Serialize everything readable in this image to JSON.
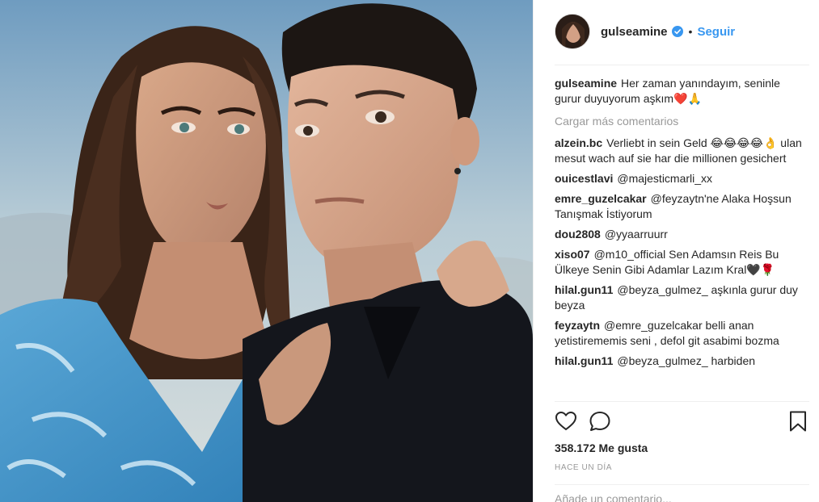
{
  "post": {
    "username": "gulseamine",
    "follow_label": "Seguir",
    "separator_dot": "•",
    "caption": {
      "username": "gulseamine",
      "text": "Her zaman yanındayım, seninle gurur duyuyorum aşkım❤️🙏"
    },
    "load_more_label": "Cargar más comentarios",
    "comments": [
      {
        "username": "alzein.bc",
        "text": "Verliebt in sein Geld 😂😂😂😂👌 ulan mesut wach auf sie har die millionen gesichert"
      },
      {
        "username": "ouicestlavi",
        "text": "@majesticmarli_xx"
      },
      {
        "username": "emre_guzelcakar",
        "text": "@feyzaytn'ne Alaka Hoşsun Tanışmak İstiyorum"
      },
      {
        "username": "dou2808",
        "text": "@yyaarruurr"
      },
      {
        "username": "xiso07",
        "text": "@m10_official Sen Adamsın Reis Bu Ülkeye Senin Gibi Adamlar Lazım Kral🖤🌹"
      },
      {
        "username": "hilal.gun11",
        "text": "@beyza_gulmez_ aşkınla gurur duy beyza"
      },
      {
        "username": "feyzaytn",
        "text": "@emre_guzelcakar belli anan yetistirememis seni , defol git asabimi bozma"
      },
      {
        "username": "hilal.gun11",
        "text": "@beyza_gulmez_ harbiden"
      }
    ],
    "likes": "358.172 Me gusta",
    "timestamp": "HACE UN DÍA",
    "add_comment_placeholder": "Añade un comentario..."
  },
  "icons": {
    "verified": "verified-badge-icon",
    "like": "heart-icon",
    "comment": "comment-bubble-icon",
    "save": "bookmark-icon"
  },
  "colors": {
    "link_blue": "#3897f0",
    "text": "#262626",
    "muted": "#999999",
    "divider": "#efefef"
  }
}
